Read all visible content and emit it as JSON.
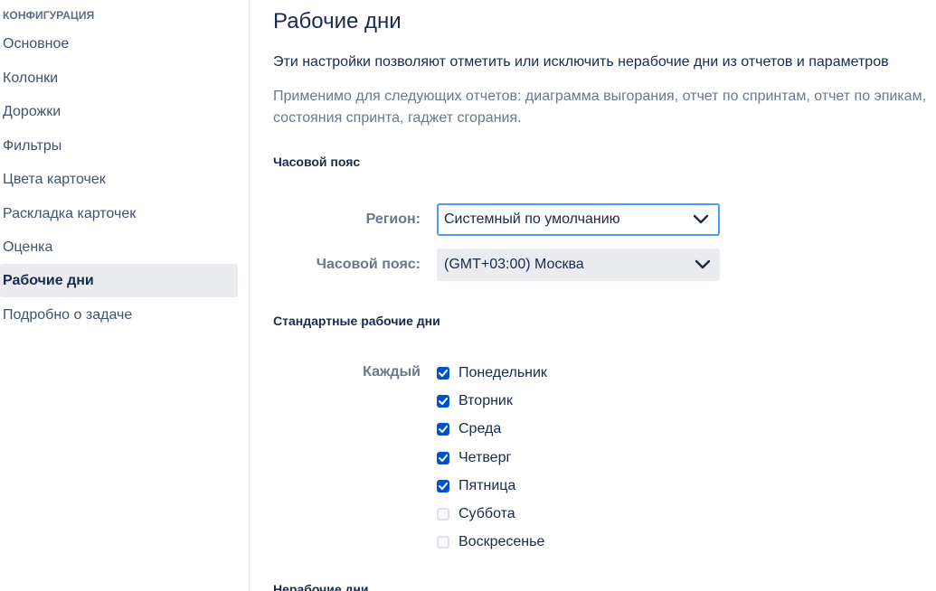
{
  "sidebar": {
    "heading": "КОНФИГУРАЦИЯ",
    "items": [
      {
        "label": "Основное"
      },
      {
        "label": "Колонки"
      },
      {
        "label": "Дорожки"
      },
      {
        "label": "Фильтры"
      },
      {
        "label": "Цвета карточек"
      },
      {
        "label": "Раскладка карточек"
      },
      {
        "label": "Оценка"
      },
      {
        "label": "Рабочие дни",
        "active": true
      },
      {
        "label": "Подробно о задаче"
      }
    ]
  },
  "main": {
    "title": "Рабочие дни",
    "description": "Эти настройки позволяют отметить или исключить нерабочие дни из отчетов и параметров",
    "applies_line1": "Применимо для следующих отчетов: диаграмма выгорания, отчет по спринтам, отчет по эпикам,",
    "applies_line2": "состояния спринта, гаджет сгорания.",
    "timezone_section": {
      "title": "Часовой пояс",
      "region_label": "Регион:",
      "region_value": "Системный по умолчанию",
      "timezone_label": "Часовой пояс:",
      "timezone_value": "(GMT+03:00) Москва"
    },
    "workdays_section": {
      "title": "Стандартные рабочие дни",
      "every_label": "Каждый",
      "days": [
        {
          "label": "Понедельник",
          "checked": true
        },
        {
          "label": "Вторник",
          "checked": true
        },
        {
          "label": "Среда",
          "checked": true
        },
        {
          "label": "Четверг",
          "checked": true
        },
        {
          "label": "Пятница",
          "checked": true
        },
        {
          "label": "Суббота",
          "checked": false
        },
        {
          "label": "Воскресенье",
          "checked": false
        }
      ]
    },
    "nonworking_section": {
      "title": "Нерабочие дни"
    }
  },
  "colors": {
    "accent": "#0052CC",
    "focus_border": "#4C9AFF",
    "active_bg": "#EBECF0"
  }
}
